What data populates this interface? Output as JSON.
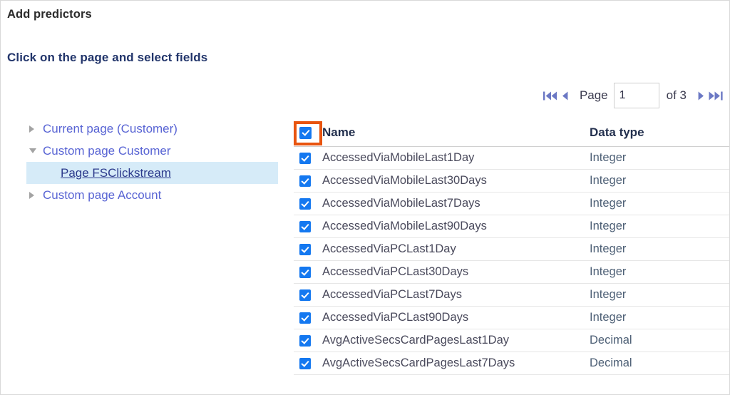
{
  "page": {
    "title": "Add predictors",
    "instruction": "Click on the page and select fields"
  },
  "pager": {
    "first_icon": "first-page-icon",
    "prev_icon": "previous-page-icon",
    "next_icon": "next-page-icon",
    "last_icon": "last-page-icon",
    "page_label": "Page",
    "page_value": "1",
    "of_label": "of 3",
    "total_pages": 3,
    "current_page": 1
  },
  "tree": {
    "items": [
      {
        "label": "Current page (Customer)",
        "expanded": false,
        "selected": false,
        "level": 0,
        "toggle_icon": "chevron-right-icon"
      },
      {
        "label": "Custom page Customer",
        "expanded": true,
        "selected": false,
        "level": 0,
        "toggle_icon": "chevron-down-icon"
      },
      {
        "label": "Page FSClickstream",
        "expanded": null,
        "selected": true,
        "level": 1,
        "toggle_icon": ""
      },
      {
        "label": "Custom page Account",
        "expanded": false,
        "selected": false,
        "level": 0,
        "toggle_icon": "chevron-right-icon"
      }
    ]
  },
  "table": {
    "header": {
      "select_all_checked": true,
      "name": "Name",
      "data_type": "Data type"
    },
    "rows": [
      {
        "checked": true,
        "name": "AccessedViaMobileLast1Day",
        "data_type": "Integer"
      },
      {
        "checked": true,
        "name": "AccessedViaMobileLast30Days",
        "data_type": "Integer"
      },
      {
        "checked": true,
        "name": "AccessedViaMobileLast7Days",
        "data_type": "Integer"
      },
      {
        "checked": true,
        "name": "AccessedViaMobileLast90Days",
        "data_type": "Integer"
      },
      {
        "checked": true,
        "name": "AccessedViaPCLast1Day",
        "data_type": "Integer"
      },
      {
        "checked": true,
        "name": "AccessedViaPCLast30Days",
        "data_type": "Integer"
      },
      {
        "checked": true,
        "name": "AccessedViaPCLast7Days",
        "data_type": "Integer"
      },
      {
        "checked": true,
        "name": "AccessedViaPCLast90Days",
        "data_type": "Integer"
      },
      {
        "checked": true,
        "name": "AvgActiveSecsCardPagesLast1Day",
        "data_type": "Decimal"
      },
      {
        "checked": true,
        "name": "AvgActiveSecsCardPagesLast7Days",
        "data_type": "Decimal"
      }
    ]
  },
  "annotation": {
    "target": "select-all-checkbox",
    "color": "#e8540f"
  },
  "colors": {
    "checkbox_blue": "#1478f0",
    "tree_link": "#5864d4",
    "tree_selected_bg": "#d6ebf8",
    "heading_sub": "#22356b",
    "pager_icon": "#6b78c4",
    "annotation": "#e8540f"
  }
}
